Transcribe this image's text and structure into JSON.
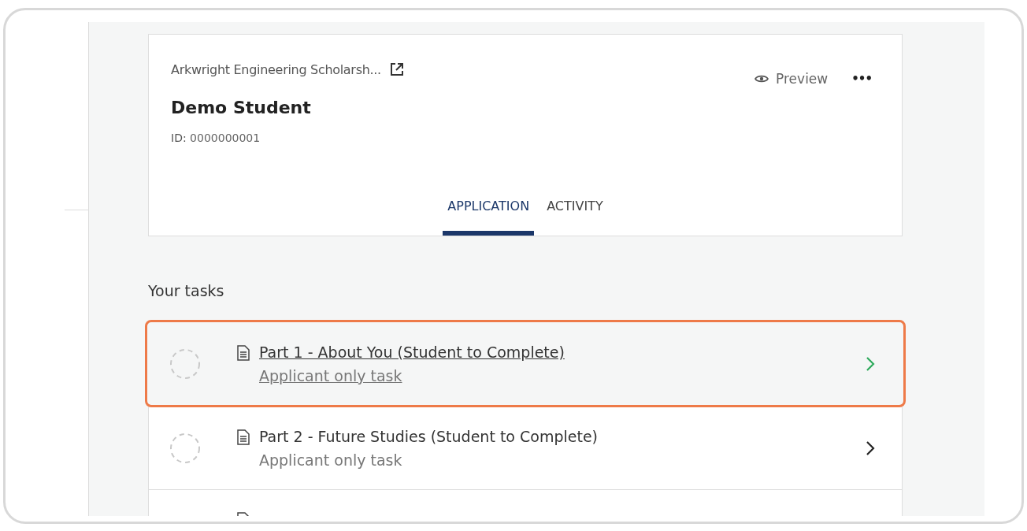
{
  "card": {
    "program": "Arkwright Engineering Scholarsh...",
    "preview": "Preview",
    "more": "•••",
    "name": "Demo Student",
    "id_label": "ID:",
    "id_value": "0000000001"
  },
  "tabs": [
    {
      "label": "APPLICATION",
      "selected": true
    },
    {
      "label": "ACTIVITY",
      "selected": false
    }
  ],
  "tasks_heading": "Your tasks",
  "tasks": [
    {
      "title": "Part 1 - About You (Student to Complete)",
      "subtitle": "Applicant only task",
      "highlighted": true
    },
    {
      "title": "Part 2 - Future Studies (Student to Complete)",
      "subtitle": "Applicant only task",
      "highlighted": false
    },
    {
      "highlighted": false
    }
  ]
}
